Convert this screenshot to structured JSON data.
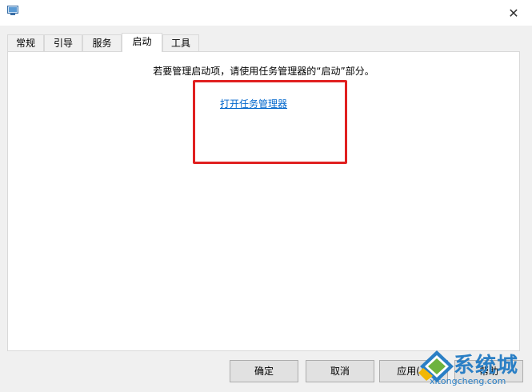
{
  "titlebar": {
    "close_glyph": "✕"
  },
  "tabs": [
    {
      "label": "常规"
    },
    {
      "label": "引导"
    },
    {
      "label": "服务"
    },
    {
      "label": "启动"
    },
    {
      "label": "工具"
    }
  ],
  "active_tab": "启动",
  "startup_panel": {
    "info_text": "若要管理启动项，请使用任务管理器的“启动”部分。",
    "link_text": "打开任务管理器"
  },
  "buttons": {
    "ok": "确定",
    "cancel": "取消",
    "apply": "应用(A)",
    "help": "帮助"
  },
  "watermark": {
    "title": "系统城",
    "subtitle": "xitongcheng.com"
  },
  "colors": {
    "link": "#0066cc",
    "highlight_border": "#e02020",
    "watermark_blue": "#2a7fc5",
    "watermark_green": "#6db33f"
  },
  "icons": {
    "app": "msconfig-icon",
    "close": "close-icon"
  }
}
